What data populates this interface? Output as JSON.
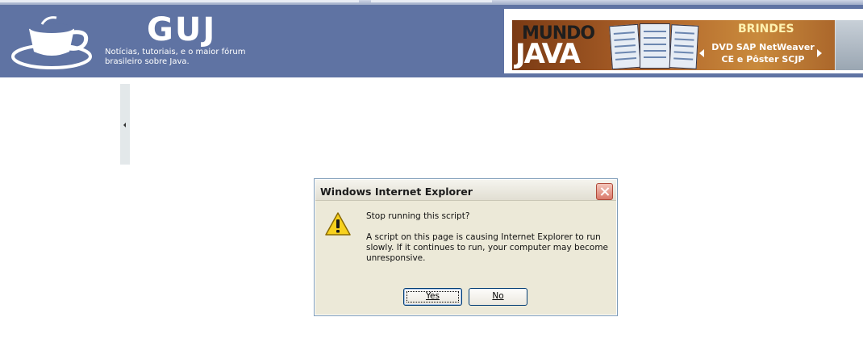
{
  "site": {
    "brand": "GUJ",
    "tagline": "Notícias, tutoriais, e o maior fórum brasileiro sobre Java."
  },
  "banner": {
    "mundo": "MUNDO",
    "java": "JAVA",
    "brindes": "BRINDES",
    "offer": "DVD SAP NetWeaver CE e Pôster SCJP"
  },
  "dialog": {
    "title": "Windows Internet Explorer",
    "question": "Stop running this script?",
    "message": "A script on this page is causing Internet Explorer to run slowly. If it continues to run, your computer may become unresponsive.",
    "yes_label": "Yes",
    "no_label": "No"
  },
  "colors": {
    "header_bg": "#5f73a3",
    "dialog_bg": "#ece9d8",
    "close_button": "#d9786a"
  },
  "icons": {
    "logo": "coffee-cup-icon",
    "warning": "warning-icon",
    "close": "close-icon",
    "sidebar": "collapse-arrow-icon"
  }
}
